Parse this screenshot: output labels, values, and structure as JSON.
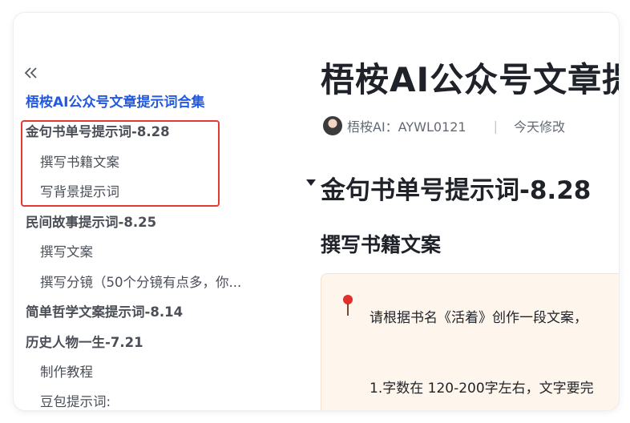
{
  "sidebar": {
    "collapse_glyph": "«",
    "doc_title": "梧桉AI公众号文章提示词合集",
    "items": [
      {
        "label": "金句书单号提示词-8.28",
        "level": 1
      },
      {
        "label": "撰写书籍文案",
        "level": 2
      },
      {
        "label": "写背景提示词",
        "level": 2
      },
      {
        "label": "民间故事提示词-8.25",
        "level": 1
      },
      {
        "label": "撰写文案",
        "level": 2
      },
      {
        "label": "撰写分镜（50个分镜有点多，你...",
        "level": 2
      },
      {
        "label": "简单哲学文案提示词-8.14",
        "level": 1
      },
      {
        "label": "历史人物一生-7.21",
        "level": 1
      },
      {
        "label": "制作教程",
        "level": 2
      },
      {
        "label": "豆包提示词:",
        "level": 2
      }
    ]
  },
  "main": {
    "title": "梧桉AI公众号文章提",
    "author": "梧桉AI：AYWL0121",
    "separator": "|",
    "modified": "今天修改",
    "heading1": "金句书单号提示词-8.28",
    "heading2": "撰写书籍文案",
    "callout": {
      "line1": "请根据书名《活着》创作一段文案，",
      "line2": "1.字数在 120-200字左右，文字要完"
    }
  },
  "colors": {
    "accent": "#2259e0",
    "highlight_border": "#e53935",
    "callout_bg": "#fef5ec"
  }
}
